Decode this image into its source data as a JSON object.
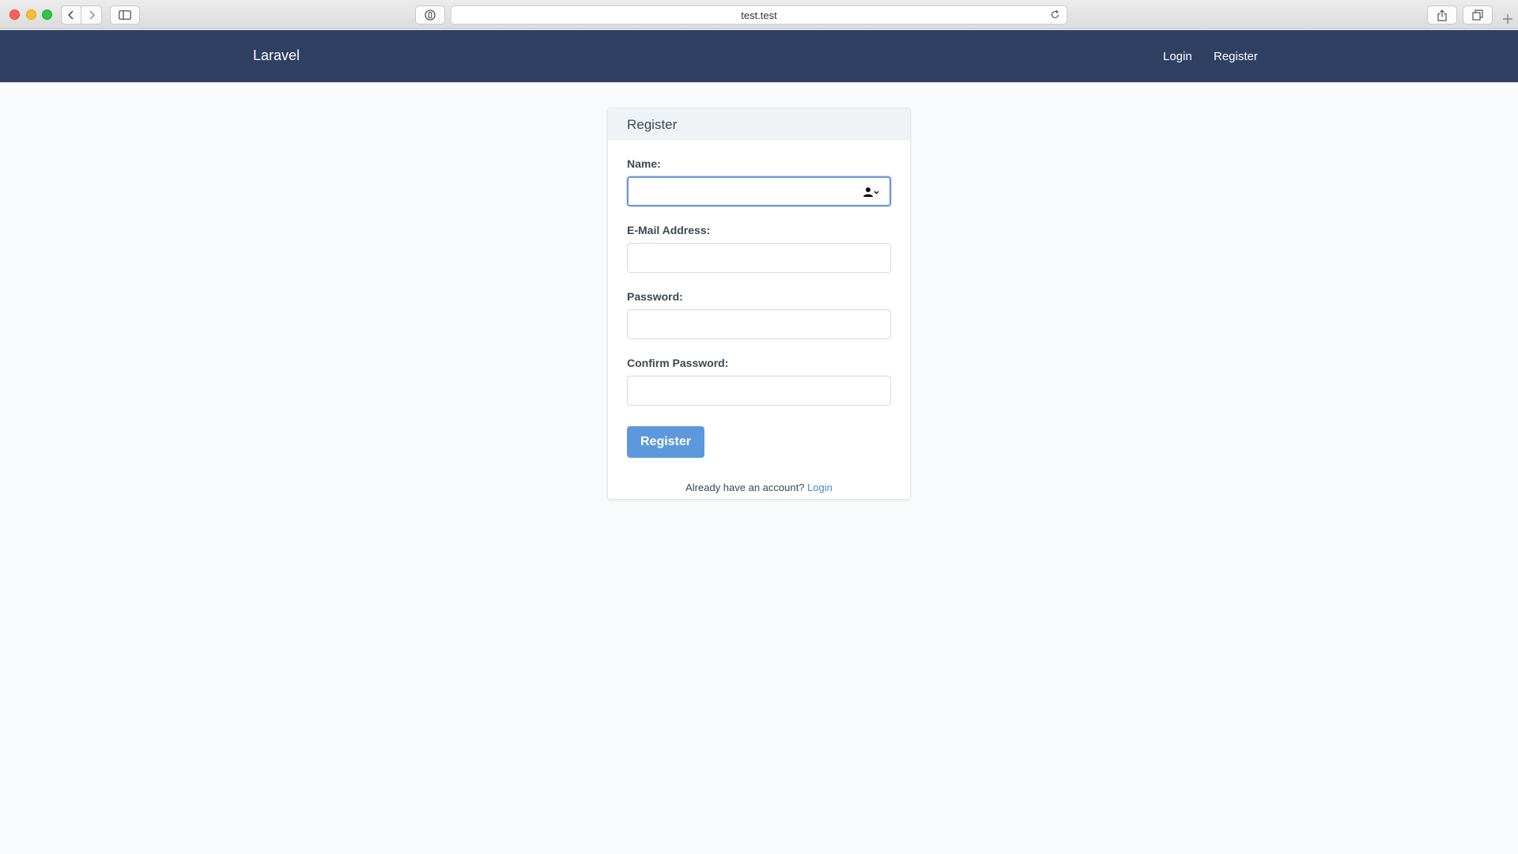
{
  "browser": {
    "url": "test.test",
    "icons": {
      "back": "chevron-left-icon",
      "forward": "chevron-right-icon",
      "sidebar": "sidebar-icon",
      "privacy": "privacy-report-icon",
      "reload": "reload-icon",
      "share": "share-icon",
      "tabs": "tab-overview-icon",
      "new_tab": "plus-icon"
    }
  },
  "navbar": {
    "brand": "Laravel",
    "links": {
      "login": "Login",
      "register": "Register"
    },
    "background": "#2f4063"
  },
  "form": {
    "title": "Register",
    "fields": {
      "name": {
        "label": "Name:",
        "value": ""
      },
      "email": {
        "label": "E-Mail Address:",
        "value": ""
      },
      "password": {
        "label": "Password:",
        "value": ""
      },
      "confirm": {
        "label": "Confirm Password:",
        "value": ""
      }
    },
    "submit_label": "Register",
    "footer_text": "Already have an account?",
    "footer_link": "Login",
    "accent": "#5d98dd"
  }
}
